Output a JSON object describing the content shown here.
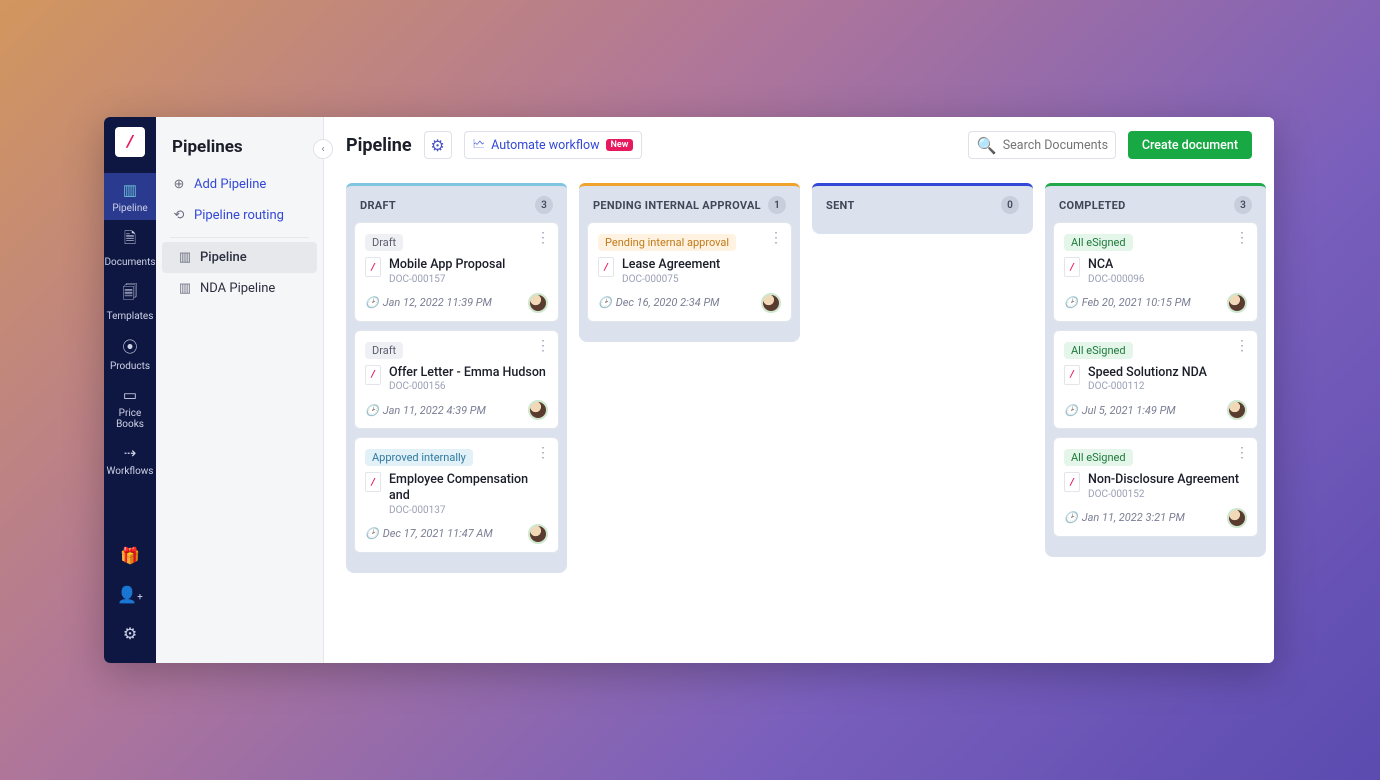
{
  "rail": {
    "items": [
      {
        "label": "Pipeline",
        "icon": "▥"
      },
      {
        "label": "Documents",
        "icon": "🗎"
      },
      {
        "label": "Templates",
        "icon": "🗐"
      },
      {
        "label": "Products",
        "icon": "⦿"
      },
      {
        "label": "Price Books",
        "icon": "▭"
      },
      {
        "label": "Workflows",
        "icon": "⇢"
      }
    ]
  },
  "panel": {
    "title": "Pipelines",
    "add_pipeline": "Add Pipeline",
    "pipeline_routing": "Pipeline routing",
    "pipelines": [
      {
        "name": "Pipeline"
      },
      {
        "name": "NDA Pipeline"
      }
    ]
  },
  "topbar": {
    "title": "Pipeline",
    "automate": "Automate workflow",
    "new_badge": "New",
    "search_placeholder": "Search Documents",
    "create": "Create document"
  },
  "columns": [
    {
      "key": "draft",
      "title": "DRAFT",
      "count": "3",
      "class": "col-draft",
      "cards": [
        {
          "status": "Draft",
          "pill": "pill-draft",
          "title": "Mobile App Proposal",
          "id": "DOC-000157",
          "ts": "Jan 12, 2022 11:39 PM"
        },
        {
          "status": "Draft",
          "pill": "pill-draft",
          "title": "Offer Letter - Emma Hudson",
          "id": "DOC-000156",
          "ts": "Jan 11, 2022 4:39 PM"
        },
        {
          "status": "Approved internally",
          "pill": "pill-approved",
          "title": "Employee Compensation and",
          "id": "DOC-000137",
          "ts": "Dec 17, 2021 11:47 AM"
        }
      ]
    },
    {
      "key": "pending",
      "title": "PENDING INTERNAL APPROVAL",
      "count": "1",
      "class": "col-pending",
      "cards": [
        {
          "status": "Pending internal approval",
          "pill": "pill-pending",
          "title": "Lease Agreement",
          "id": "DOC-000075",
          "ts": "Dec 16, 2020 2:34 PM"
        }
      ]
    },
    {
      "key": "sent",
      "title": "SENT",
      "count": "0",
      "class": "col-sent",
      "cards": []
    },
    {
      "key": "completed",
      "title": "COMPLETED",
      "count": "3",
      "class": "col-completed",
      "cards": [
        {
          "status": "All eSigned",
          "pill": "pill-esigned",
          "title": "NCA",
          "id": "DOC-000096",
          "ts": "Feb 20, 2021 10:15 PM"
        },
        {
          "status": "All eSigned",
          "pill": "pill-esigned",
          "title": "Speed Solutionz NDA",
          "id": "DOC-000112",
          "ts": "Jul 5, 2021 1:49 PM"
        },
        {
          "status": "All eSigned",
          "pill": "pill-esigned",
          "title": "Non-Disclosure Agreement",
          "id": "DOC-000152",
          "ts": "Jan 11, 2022 3:21 PM"
        }
      ]
    }
  ]
}
